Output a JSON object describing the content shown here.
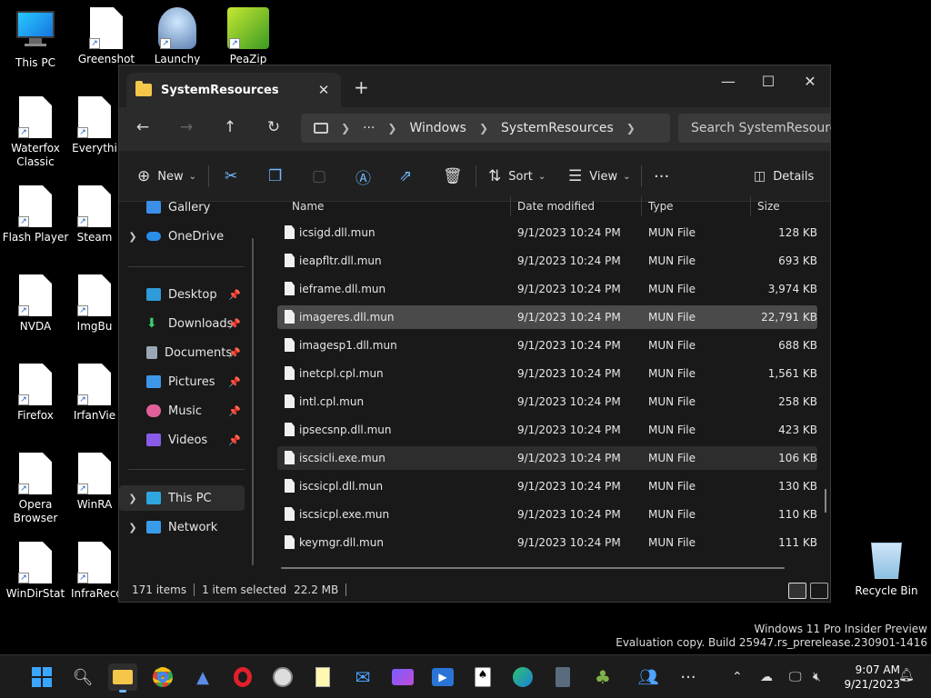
{
  "desktop": {
    "icons": [
      {
        "label": "This PC"
      },
      {
        "label": "Greenshot"
      },
      {
        "label": "Launchy"
      },
      {
        "label": "PeaZip"
      },
      {
        "label": "Waterfox Classic"
      },
      {
        "label": "Everythi"
      },
      {
        "label": "Flash Player"
      },
      {
        "label": "Steam"
      },
      {
        "label": "NVDA"
      },
      {
        "label": "ImgBu"
      },
      {
        "label": "Firefox"
      },
      {
        "label": "IrfanVie"
      },
      {
        "label": "Opera Browser"
      },
      {
        "label": "WinRA"
      },
      {
        "label": "WinDirStat"
      },
      {
        "label": "InfraReco"
      }
    ],
    "recycle_bin": "Recycle Bin",
    "watermark_line1": "Windows 11 Pro Insider Preview",
    "watermark_line2": "Evaluation copy. Build 25947.rs_prerelease.230901-1416"
  },
  "explorer": {
    "tab_title": "SystemResources",
    "tab_close": "✕",
    "new_tab": "+",
    "window_controls": {
      "minimize": "—",
      "maximize": "☐",
      "close": "✕"
    },
    "nav": {
      "back": "←",
      "forward": "→",
      "up": "↑",
      "refresh": "↻"
    },
    "breadcrumb": {
      "more": "···",
      "segments": [
        "Windows",
        "SystemResources"
      ]
    },
    "search_placeholder": "Search SystemResources",
    "commands": {
      "new": "New",
      "sort": "Sort",
      "view": "View",
      "more": "···",
      "details": "Details"
    },
    "navpane": {
      "items": [
        {
          "label": "Gallery"
        },
        {
          "label": "OneDrive"
        },
        {
          "label": "Desktop"
        },
        {
          "label": "Downloads"
        },
        {
          "label": "Documents"
        },
        {
          "label": "Pictures"
        },
        {
          "label": "Music"
        },
        {
          "label": "Videos"
        },
        {
          "label": "This PC"
        },
        {
          "label": "Network"
        }
      ]
    },
    "columns": {
      "name": "Name",
      "date": "Date modified",
      "type": "Type",
      "size": "Size"
    },
    "files": [
      {
        "name": "icsigd.dll.mun",
        "date": "9/1/2023 10:24 PM",
        "type": "MUN File",
        "size": "128 KB"
      },
      {
        "name": "ieapfltr.dll.mun",
        "date": "9/1/2023 10:24 PM",
        "type": "MUN File",
        "size": "693 KB"
      },
      {
        "name": "ieframe.dll.mun",
        "date": "9/1/2023 10:24 PM",
        "type": "MUN File",
        "size": "3,974 KB"
      },
      {
        "name": "imageres.dll.mun",
        "date": "9/1/2023 10:24 PM",
        "type": "MUN File",
        "size": "22,791 KB"
      },
      {
        "name": "imagesp1.dll.mun",
        "date": "9/1/2023 10:24 PM",
        "type": "MUN File",
        "size": "688 KB"
      },
      {
        "name": "inetcpl.cpl.mun",
        "date": "9/1/2023 10:24 PM",
        "type": "MUN File",
        "size": "1,561 KB"
      },
      {
        "name": "intl.cpl.mun",
        "date": "9/1/2023 10:24 PM",
        "type": "MUN File",
        "size": "258 KB"
      },
      {
        "name": "ipsecsnp.dll.mun",
        "date": "9/1/2023 10:24 PM",
        "type": "MUN File",
        "size": "423 KB"
      },
      {
        "name": "iscsicli.exe.mun",
        "date": "9/1/2023 10:24 PM",
        "type": "MUN File",
        "size": "106 KB"
      },
      {
        "name": "iscsicpl.dll.mun",
        "date": "9/1/2023 10:24 PM",
        "type": "MUN File",
        "size": "130 KB"
      },
      {
        "name": "iscsicpl.exe.mun",
        "date": "9/1/2023 10:24 PM",
        "type": "MUN File",
        "size": "110 KB"
      },
      {
        "name": "keymgr.dll.mun",
        "date": "9/1/2023 10:24 PM",
        "type": "MUN File",
        "size": "111 KB"
      }
    ],
    "status": {
      "count": "171 items",
      "selected": "1 item selected",
      "size": "22.2 MB"
    }
  },
  "taskbar": {
    "clock_time": "9:07 AM",
    "clock_date": "9/21/2023",
    "more": "···"
  }
}
